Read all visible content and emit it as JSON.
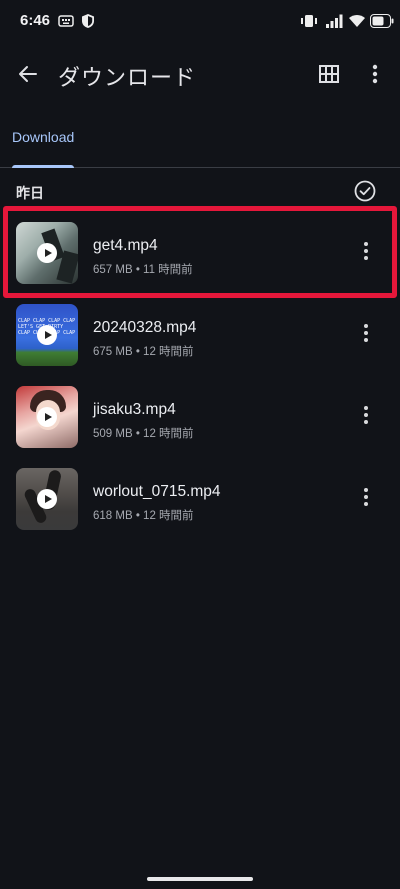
{
  "status_bar": {
    "time": "6:46"
  },
  "app_bar": {
    "title": "ダウンロード"
  },
  "tabs": [
    {
      "label": "Download",
      "selected": true
    }
  ],
  "section": {
    "title": "昨日"
  },
  "files": [
    {
      "name": "get4.mp4",
      "meta": "657 MB • 11 時間前",
      "highlighted": true
    },
    {
      "name": "20240328.mp4",
      "meta": "675 MB • 12 時間前"
    },
    {
      "name": "jisaku3.mp4",
      "meta": "509 MB • 12 時間前"
    },
    {
      "name": "worlout_0715.mp4",
      "meta": "618 MB • 12 時間前"
    }
  ],
  "thumb_text": "CLAP CLAP CLAP CLAP LET'S GET DIRTY CLAP CLAP CLAP CLAP LET'S GET DIRTY",
  "colors": {
    "background": "#111318",
    "accent": "#a8c7fa",
    "highlight": "#e5173a"
  },
  "icons": {
    "back": "arrow-back-icon",
    "grid": "grid-view-icon",
    "more": "more-vert-icon",
    "select_all": "check-circle-icon",
    "play": "play-icon"
  }
}
